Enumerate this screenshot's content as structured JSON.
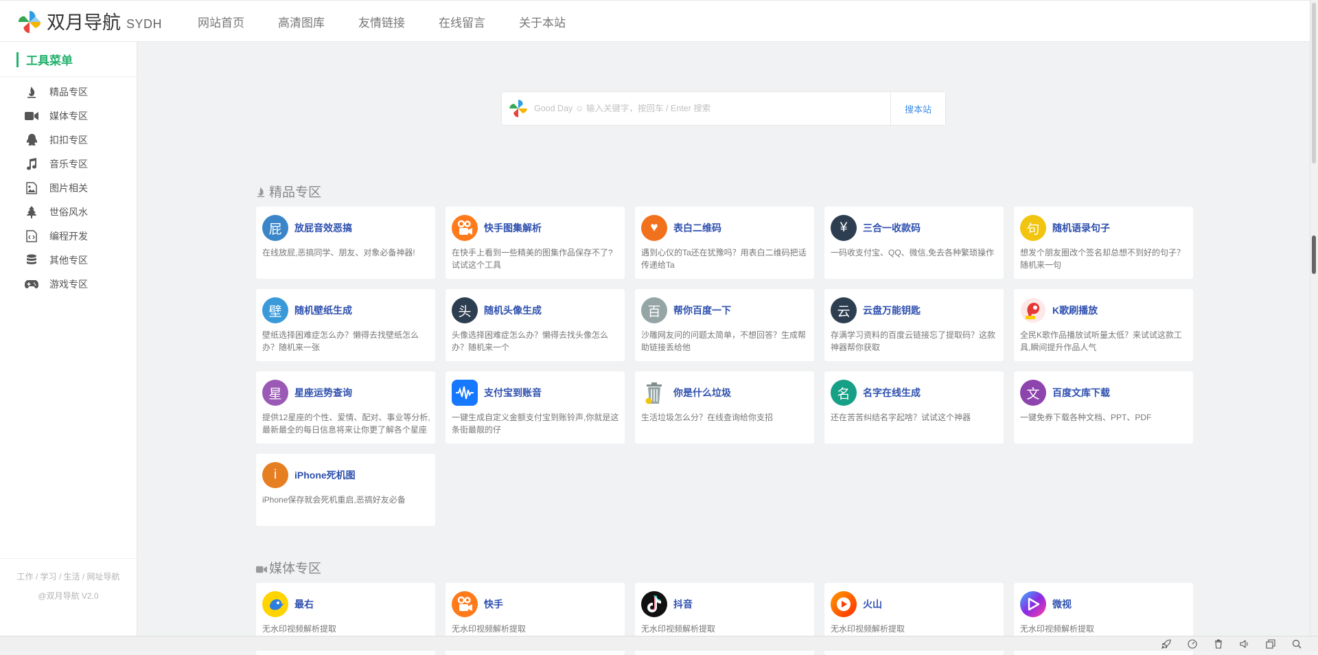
{
  "brand": {
    "title": "双月导航",
    "subtitle": "SYDH"
  },
  "topnav": [
    {
      "label": "网站首页"
    },
    {
      "label": "高清图库"
    },
    {
      "label": "友情链接"
    },
    {
      "label": "在线留言"
    },
    {
      "label": "关于本站"
    }
  ],
  "sidebar": {
    "heading": "工具菜单",
    "items": [
      {
        "label": "精品专区",
        "icon": "flame-icon"
      },
      {
        "label": "媒体专区",
        "icon": "video-camera-icon"
      },
      {
        "label": "扣扣专区",
        "icon": "qq-penguin-icon"
      },
      {
        "label": "音乐专区",
        "icon": "music-note-icon"
      },
      {
        "label": "图片相关",
        "icon": "image-icon"
      },
      {
        "label": "世俗风水",
        "icon": "tree-icon"
      },
      {
        "label": "编程开发",
        "icon": "code-file-icon"
      },
      {
        "label": "其他专区",
        "icon": "database-icon"
      },
      {
        "label": "游戏专区",
        "icon": "gamepad-icon"
      }
    ],
    "footer_line1": "工作 / 学习 / 生活 / 网址导航",
    "footer_line2": "@双月导航 V2.0"
  },
  "search": {
    "placeholder": "Good Day ☺ 输入关键字，按回车 / Enter 搜索",
    "button": "搜本站"
  },
  "sections": [
    {
      "title": "精品专区",
      "cards": [
        {
          "name": "放屁音效恶搞",
          "desc": "在线放屁,恶搞同学、朋友、对象必备神器!",
          "glyph": "屁",
          "color": "#3a86c8"
        },
        {
          "name": "快手图集解析",
          "desc": "在快手上看到一些精美的图集作品保存不了?试试这个工具",
          "glyph": "",
          "color": "#ff7a1a"
        },
        {
          "name": "表白二维码",
          "desc": "遇到心仪的Ta还在犹豫吗？用表白二维码把话传递给Ta",
          "glyph": "♥",
          "color": "#f2711c"
        },
        {
          "name": "三合一收款码",
          "desc": "一码收支付宝、QQ、微信,免去各种繁琐操作",
          "glyph": "¥",
          "color": "#2c3e50"
        },
        {
          "name": "随机语录句子",
          "desc": "想发个朋友圈改个签名却总想不到好的句子？随机来一句",
          "glyph": "句",
          "color": "#f1c40f"
        },
        {
          "name": "随机壁纸生成",
          "desc": "壁纸选择困难症怎么办？懒得去找壁纸怎么办？随机来一张",
          "glyph": "壁",
          "color": "#3a9ad9"
        },
        {
          "name": "随机头像生成",
          "desc": "头像选择困难症怎么办？懒得去找头像怎么办？随机来一个",
          "glyph": "头",
          "color": "#2c3e50"
        },
        {
          "name": "帮你百度一下",
          "desc": "沙雕网友问的问题太简单，不想回答？生成帮助链接丢给他",
          "glyph": "百",
          "color": "#95a5a6"
        },
        {
          "name": "云盘万能钥匙",
          "desc": "存满学习资料的百度云链接忘了提取码？这款神器帮你获取",
          "glyph": "云",
          "color": "#2c3e50"
        },
        {
          "name": "K歌刷播放",
          "desc": "全民K歌作品播放试听量太低？来试试这款工具,瞬间提升作品人气",
          "glyph": "",
          "color": "#e53935"
        },
        {
          "name": "星座运势查询",
          "desc": "提供12星座的个性、爱情、配对、事业等分析,最新最全的每日信息将来让你更了解各个星座",
          "glyph": "星",
          "color": "#9b59b6"
        },
        {
          "name": "支付宝到账音",
          "desc": "一键生成自定义金额支付宝到账铃声,你就是这条街最靓的仔",
          "glyph": "",
          "color": "#1677ff"
        },
        {
          "name": "你是什么垃圾",
          "desc": "生活垃圾怎么分？在线查询给你支招",
          "glyph": "",
          "color": "#ffffff"
        },
        {
          "name": "名字在线生成",
          "desc": "还在苦苦纠结名字起啥？试试这个神器",
          "glyph": "名",
          "color": "#16a085"
        },
        {
          "name": "百度文库下载",
          "desc": "一键免券下载各种文档、PPT、PDF",
          "glyph": "文",
          "color": "#8e44ad"
        },
        {
          "name": "iPhone死机图",
          "desc": "iPhone保存就会死机重启,恶搞好友必备",
          "glyph": "i",
          "color": "#e67e22"
        }
      ]
    },
    {
      "title": "媒体专区",
      "cards": [
        {
          "name": "最右",
          "desc": "无水印视频解析提取",
          "glyph": "",
          "color": "#ffd400"
        },
        {
          "name": "快手",
          "desc": "无水印视频解析提取",
          "glyph": "",
          "color": "#ff7a1a"
        },
        {
          "name": "抖音",
          "desc": "无水印视频解析提取",
          "glyph": "",
          "color": "#111111"
        },
        {
          "name": "火山",
          "desc": "无水印视频解析提取",
          "glyph": "",
          "color": "#ff3d00"
        },
        {
          "name": "微视",
          "desc": "无水印视频解析提取",
          "glyph": "",
          "color": "#7b3fe4"
        }
      ]
    }
  ]
}
